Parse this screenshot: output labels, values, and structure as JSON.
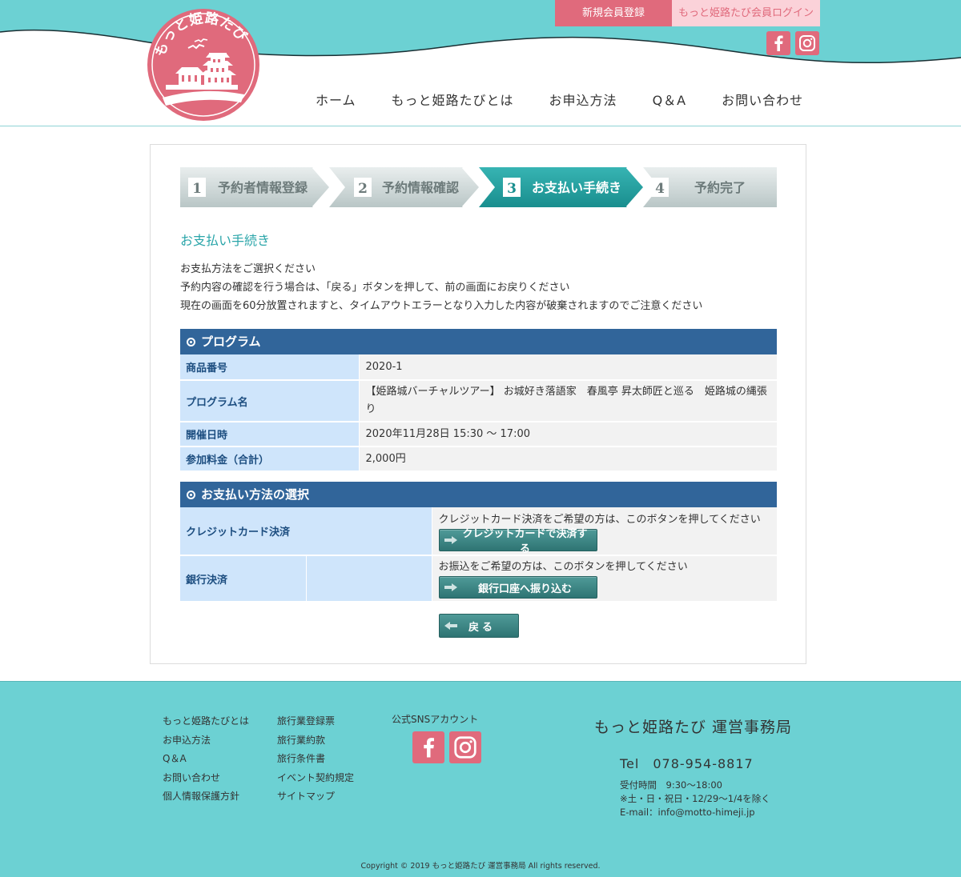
{
  "header": {
    "logo_text": "もっと姫路たび",
    "register_label": "新規会員登録",
    "login_label": "もっと姫路たび会員ログイン",
    "nav": [
      "ホーム",
      "もっと姫路たびとは",
      "お申込方法",
      "Q＆A",
      "お問い合わせ"
    ]
  },
  "steps": [
    {
      "num": "1",
      "label": "予約者情報登録",
      "active": false
    },
    {
      "num": "2",
      "label": "予約情報確認",
      "active": false
    },
    {
      "num": "3",
      "label": "お支払い手続き",
      "active": true
    },
    {
      "num": "4",
      "label": "予約完了",
      "active": false
    }
  ],
  "page": {
    "heading": "お支払い手続き",
    "intro": [
      "お支払方法をご選択ください",
      "予約内容の確認を行う場合は、「戻る」ボタンを押して、前の画面にお戻りください",
      "現在の画面を60分放置されますと、タイムアウトエラーとなり入力した内容が破棄されますのでご注意ください"
    ]
  },
  "program": {
    "title": "プログラム",
    "rows": [
      {
        "label": "商品番号",
        "value": "2020-1"
      },
      {
        "label": "プログラム名",
        "value": "【姫路城バーチャルツアー】 お城好き落語家　春風亭 昇太師匠と巡る　姫路城の縄張り"
      },
      {
        "label": "開催日時",
        "value": "2020年11月28日 15:30 〜 17:00"
      },
      {
        "label": "参加料金（合計）",
        "value": "2,000円"
      }
    ]
  },
  "payment": {
    "title": "お支払い方法の選択",
    "credit": {
      "label": "クレジットカード決済",
      "note": "クレジットカード決済をご希望の方は、このボタンを押してください",
      "button": "クレジットカードで決済する"
    },
    "bank": {
      "label": "銀行決済",
      "note": "お振込をご希望の方は、このボタンを押してください",
      "button": "銀行口座へ振り込む"
    },
    "back_button": "戻る"
  },
  "footer": {
    "col1": [
      "もっと姫路たびとは",
      "お申込方法",
      "Q＆A",
      "お問い合わせ",
      "個人情報保護方針"
    ],
    "col2": [
      "旅行業登録票",
      "旅行業約款",
      "旅行条件書",
      "イベント契約規定",
      "サイトマップ"
    ],
    "sns_title": "公式SNSアカウント",
    "office_name": "もっと姫路たび 運営事務局",
    "tel": "Tel　078-954-8817",
    "hours": "受付時間　9:30〜18:00",
    "holidays": "※土・日・祝日・12/29〜1/4を除く",
    "email": "E-mail：info@motto-himeji.jp",
    "copyright": "Copyright © 2019 もっと姫路たび 運営事務局 All rights reserved."
  },
  "colors": {
    "teal": "#6cd1d3",
    "pink": "#e06a7c",
    "navy": "#31659a",
    "step_active": "#2aa5a9"
  },
  "icons": [
    "facebook-icon",
    "instagram-icon",
    "arrow-right-icon",
    "arrow-left-icon",
    "castle-logo-icon"
  ]
}
